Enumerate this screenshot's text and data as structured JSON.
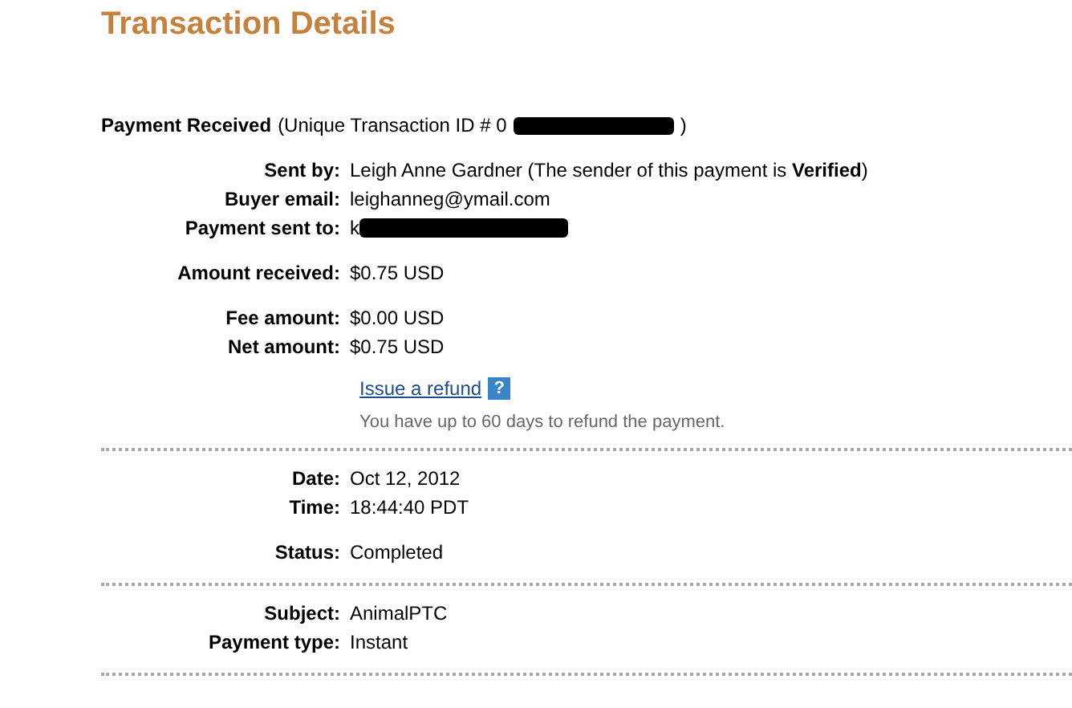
{
  "title": "Transaction Details",
  "header": {
    "label": "Payment Received",
    "text": "(Unique Transaction ID # 0",
    "closing": ")"
  },
  "sections": [
    {
      "groups": [
        [
          {
            "label": "Sent by:",
            "kind": "text",
            "value": "Leigh Anne Gardner (The sender of this payment is **Verified**)"
          },
          {
            "label": "Buyer email:",
            "kind": "text",
            "value": "leighanneg@ymail.com"
          },
          {
            "label": "Payment sent to:",
            "kind": "redacted",
            "value": "k"
          }
        ],
        [
          {
            "label": "Amount received:",
            "kind": "text",
            "value": "$0.75 USD"
          }
        ],
        [
          {
            "label": "Fee amount:",
            "kind": "text",
            "value": "$0.00 USD"
          },
          {
            "label": "Net amount:",
            "kind": "text",
            "value": "$0.75 USD"
          }
        ]
      ],
      "refund": {
        "link": "Issue a refund",
        "help": "?",
        "note": "You have up to 60 days to refund the payment."
      }
    },
    {
      "groups": [
        [
          {
            "label": "Date:",
            "kind": "text",
            "value": "Oct 12, 2012"
          },
          {
            "label": "Time:",
            "kind": "text",
            "value": "18:44:40 PDT"
          }
        ],
        [
          {
            "label": "Status:",
            "kind": "text",
            "value": "Completed"
          }
        ]
      ]
    },
    {
      "groups": [
        [
          {
            "label": "Subject:",
            "kind": "text",
            "value": "AnimalPTC"
          },
          {
            "label": "Payment type:",
            "kind": "text",
            "value": "Instant"
          }
        ]
      ]
    }
  ]
}
